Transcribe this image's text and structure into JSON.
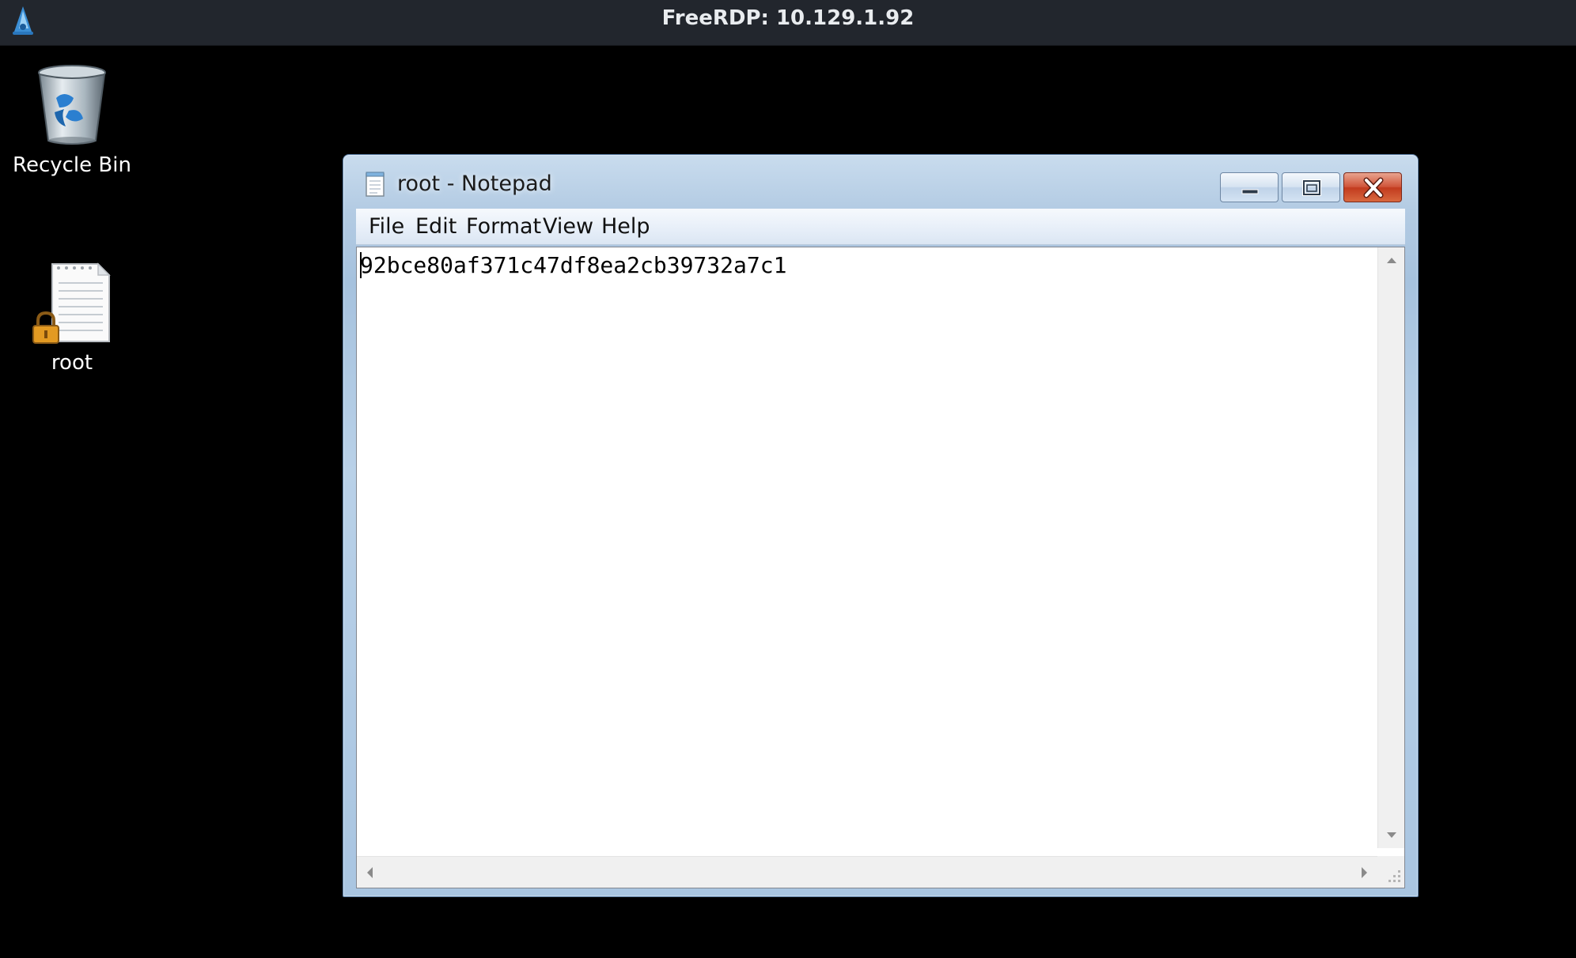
{
  "rdp": {
    "title": "FreeRDP: 10.129.1.92",
    "logo_icon": "freerdp-logo-icon"
  },
  "desktop": {
    "icons": [
      {
        "label": "Recycle Bin",
        "icon": "recycle-bin-icon"
      },
      {
        "label": "root",
        "icon": "locked-text-file-icon"
      }
    ]
  },
  "notepad": {
    "title": "root - Notepad",
    "icon": "notepad-icon",
    "menu": [
      "File",
      "Edit",
      "Format",
      "View",
      "Help"
    ],
    "content": "92bce80af371c47df8ea2cb39732a7c1",
    "buttons": {
      "minimize": "minimize-icon",
      "maximize": "maximize-icon",
      "close": "close-icon"
    }
  },
  "colors": {
    "desktop_background": "#000000",
    "rdp_bar": "#22262d",
    "window_frame": "#b3cbe3",
    "close_button": "#c23b1e"
  }
}
